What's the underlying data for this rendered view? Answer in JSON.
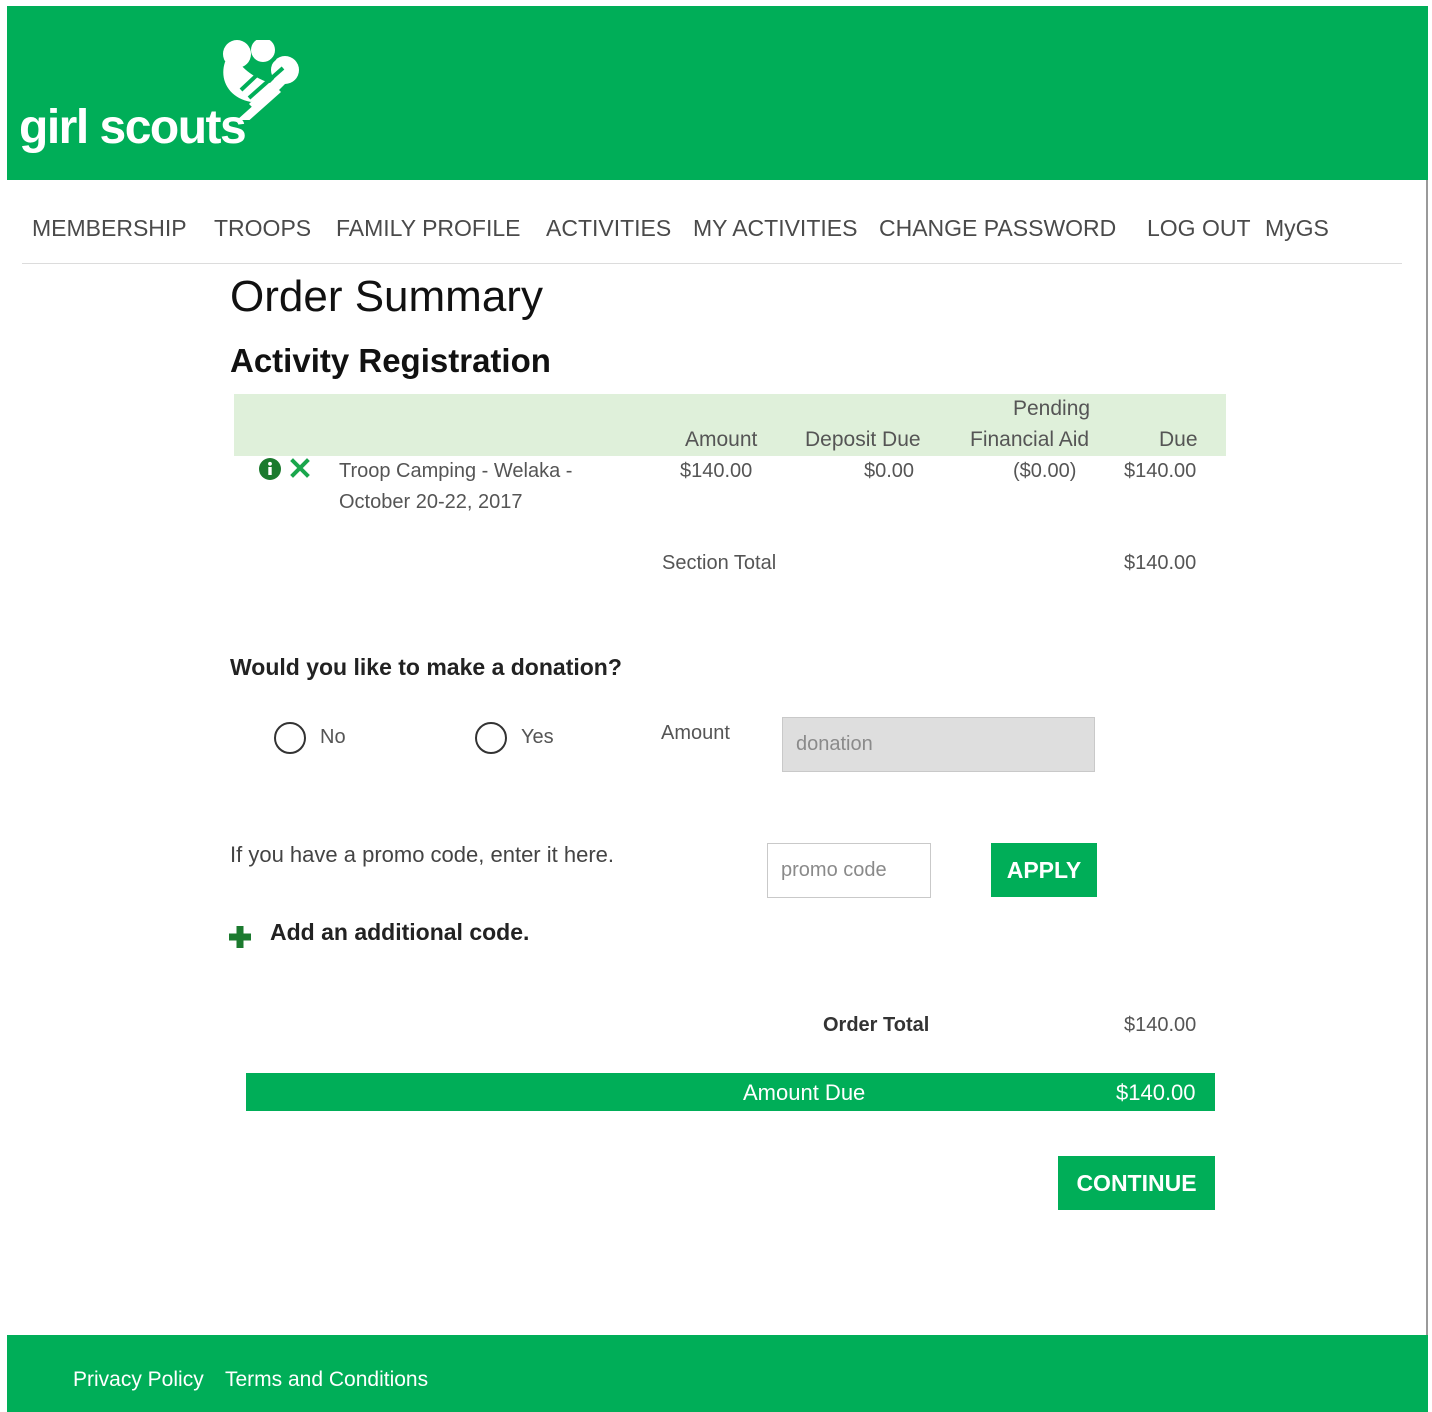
{
  "brand": {
    "logo_text": "girl scouts",
    "color": "#00ae58"
  },
  "nav": {
    "items": [
      "MEMBERSHIP",
      "TROOPS",
      "FAMILY PROFILE",
      "ACTIVITIES",
      "MY ACTIVITIES",
      "CHANGE PASSWORD",
      "LOG OUT",
      "MyGS"
    ]
  },
  "page": {
    "title": "Order Summary",
    "section_title": "Activity Registration"
  },
  "table": {
    "headers": {
      "amount": "Amount",
      "deposit_due": "Deposit Due",
      "pending_line1": "Pending",
      "pending_line2": "Financial Aid",
      "due": "Due"
    },
    "rows": [
      {
        "item_line1": "Troop Camping - Welaka -",
        "item_line2": "October 20-22, 2017",
        "amount": "$140.00",
        "deposit_due": "$0.00",
        "pending_financial_aid": "($0.00)",
        "due": "$140.00",
        "icons": [
          "info-icon",
          "remove-icon"
        ]
      }
    ],
    "section_total_label": "Section Total",
    "section_total_value": "$140.00"
  },
  "donation": {
    "question": "Would you like to make a donation?",
    "options": [
      "No",
      "Yes"
    ],
    "amount_label": "Amount",
    "amount_placeholder": "donation"
  },
  "promo": {
    "prompt": "If you have a promo code, enter it here.",
    "placeholder": "promo code",
    "apply_label": "APPLY",
    "add_code_label": "Add an additional code."
  },
  "totals": {
    "order_total_label": "Order Total",
    "order_total_value": "$140.00",
    "amount_due_label": "Amount Due",
    "amount_due_value": "$140.00"
  },
  "actions": {
    "continue_label": "CONTINUE"
  },
  "footer": {
    "links": [
      "Privacy Policy",
      "Terms and Conditions"
    ]
  }
}
